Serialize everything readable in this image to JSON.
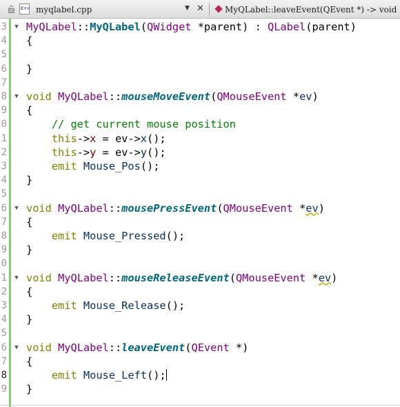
{
  "tabbar": {
    "file_icon_text": "C++",
    "file_name": "myqlabel.cpp",
    "dropdown_glyph": "▼",
    "close_glyph": "✕",
    "function_signature": "MyQLabel::leaveEvent(QEvent *) -> void"
  },
  "colors": {
    "keyword": "#808000",
    "type": "#800080",
    "function": "#00677c",
    "comment": "#008000",
    "member": "#800000",
    "change_marker": "#7ccf6a"
  },
  "icons": [
    "lock-icon",
    "cpp-file-icon",
    "dropdown-arrow-icon",
    "close-icon",
    "method-icon",
    "fold-arrow-icon"
  ],
  "line_numbers": [
    "3",
    "4",
    "5",
    "6",
    "7",
    "8",
    "9",
    "0",
    "1",
    "2",
    "3",
    "4",
    "5",
    "6",
    "7",
    "8",
    "9",
    "0",
    "1",
    "2",
    "3",
    "4",
    "5",
    "6",
    "7",
    "8",
    "9"
  ],
  "code": {
    "class_name": "MyQLabel",
    "scope": "::",
    "ctor": "MyQLabel",
    "ctor_params_open": "(",
    "qwidget": "QWidget",
    "ptr_param": " *parent) : ",
    "qlabel": "QLabel",
    "ctor_init": "(parent)",
    "lbrace": "{",
    "rbrace": "}",
    "void": "void",
    "move_fn": "mouseMoveEvent",
    "press_fn": "mousePressEvent",
    "release_fn": "mouseReleaseEvent",
    "leave_fn": "leaveEvent",
    "qmouseevent": "QMouseEvent",
    "qevent": "QEvent",
    "ev_param": "ev",
    "ptr_star": " *",
    "lparen": "(",
    "rparen": ")",
    "ptr_only": " *)",
    "comment": "// get current mouse position",
    "this_kw": "this",
    "arrow": "->",
    "x": "x",
    "y": "y",
    "assign_x": " = ev->",
    "call_end": "();",
    "emit": "emit",
    "mouse_pos": "Mouse_Pos",
    "mouse_pressed": "Mouse_Pressed",
    "mouse_release": "Mouse_Release",
    "mouse_left": "Mouse_Left"
  }
}
